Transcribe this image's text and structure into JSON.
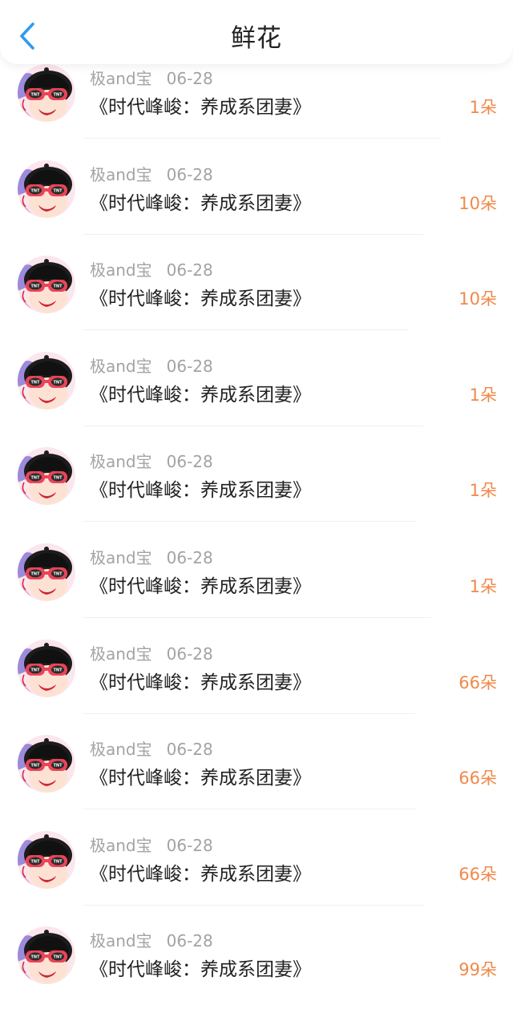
{
  "header": {
    "title": "鲜花",
    "back_icon": "chevron-left-icon",
    "accent_color": "#2e9bf0"
  },
  "avatar": {
    "text": "TNT"
  },
  "records": [
    {
      "user": "极and宝",
      "date": "06-28",
      "book": "《时代峰峻：养成系团妻》",
      "count": "1朵"
    },
    {
      "user": "极and宝",
      "date": "06-28",
      "book": "《时代峰峻：养成系团妻》",
      "count": "10朵"
    },
    {
      "user": "极and宝",
      "date": "06-28",
      "book": "《时代峰峻：养成系团妻》",
      "count": "10朵"
    },
    {
      "user": "极and宝",
      "date": "06-28",
      "book": "《时代峰峻：养成系团妻》",
      "count": "1朵"
    },
    {
      "user": "极and宝",
      "date": "06-28",
      "book": "《时代峰峻：养成系团妻》",
      "count": "1朵"
    },
    {
      "user": "极and宝",
      "date": "06-28",
      "book": "《时代峰峻：养成系团妻》",
      "count": "1朵"
    },
    {
      "user": "极and宝",
      "date": "06-28",
      "book": "《时代峰峻：养成系团妻》",
      "count": "66朵"
    },
    {
      "user": "极and宝",
      "date": "06-28",
      "book": "《时代峰峻：养成系团妻》",
      "count": "66朵"
    },
    {
      "user": "极and宝",
      "date": "06-28",
      "book": "《时代峰峻：养成系团妻》",
      "count": "66朵"
    },
    {
      "user": "极and宝",
      "date": "06-28",
      "book": "《时代峰峻：养成系团妻》",
      "count": "99朵"
    }
  ],
  "colors": {
    "count": "#f0894a",
    "meta": "#a3a3a3",
    "text": "#222222"
  }
}
